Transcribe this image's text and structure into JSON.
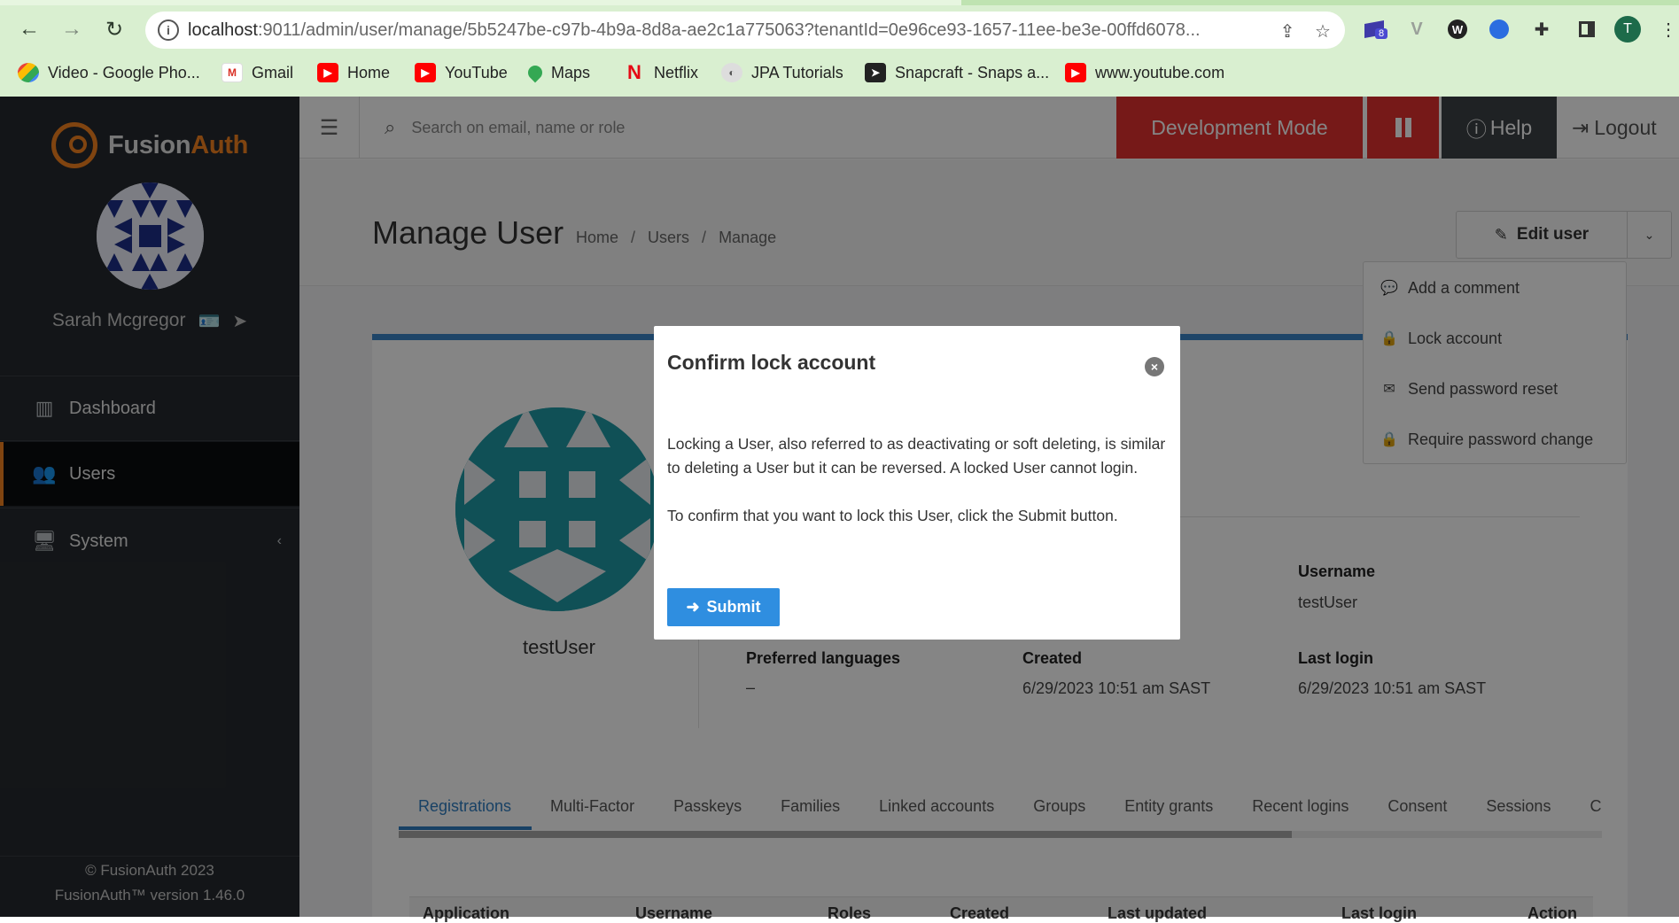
{
  "browser": {
    "url_host": "localhost",
    "url_rest": ":9011/admin/user/manage/5b5247be-c97b-4b9a-8d8a-ae2c1a775063?tenantId=0e96ce93-1657-11ee-be3e-00ffd6078...",
    "extension_badge": "8",
    "profile_initial": "T",
    "bookmarks": [
      {
        "label": "Video - Google Pho...",
        "icon": "google-photos-icon"
      },
      {
        "label": "Gmail",
        "icon": "gmail-icon"
      },
      {
        "label": "Home",
        "icon": "youtube-icon"
      },
      {
        "label": "YouTube",
        "icon": "youtube-icon"
      },
      {
        "label": "Maps",
        "icon": "maps-icon"
      },
      {
        "label": "Netflix",
        "icon": "netflix-icon"
      },
      {
        "label": "JPA Tutorials",
        "icon": "jpa-icon"
      },
      {
        "label": "Snapcraft - Snaps a...",
        "icon": "snapcraft-icon"
      },
      {
        "label": "www.youtube.com",
        "icon": "youtube-icon"
      }
    ]
  },
  "sidebar": {
    "logo_part1": "Fusion",
    "logo_part2": "Auth",
    "user_name": "Sarah Mcgregor",
    "items": [
      {
        "label": "Dashboard",
        "icon": "dashboard-icon"
      },
      {
        "label": "Users",
        "icon": "users-icon"
      },
      {
        "label": "System",
        "icon": "monitor-icon",
        "chevron": "‹"
      }
    ],
    "footer_copyright": "© FusionAuth 2023",
    "footer_version": "FusionAuth™ version 1.46.0"
  },
  "topbar": {
    "search_placeholder": "Search on email, name or role",
    "dev_mode": "Development Mode",
    "help": "Help",
    "logout": "Logout"
  },
  "page": {
    "title": "Manage User",
    "breadcrumb": [
      "Home",
      "Users",
      "Manage"
    ],
    "edit_user": "Edit user"
  },
  "dropdown": {
    "items": [
      {
        "label": "Add a comment",
        "icon": "comment-icon"
      },
      {
        "label": "Lock account",
        "icon": "lock-icon"
      },
      {
        "label": "Send password reset",
        "icon": "envelope-icon"
      },
      {
        "label": "Require password change",
        "icon": "lock-icon"
      }
    ]
  },
  "user": {
    "display_name": "testUser",
    "fields": {
      "username_label": "Username",
      "username_value": "testUser",
      "preferred_languages_label": "Preferred languages",
      "preferred_languages_value": "–",
      "created_label": "Created",
      "created_value": "6/29/2023 10:51 am SAST",
      "last_login_label": "Last login",
      "last_login_value": "6/29/2023 10:51 am SAST"
    }
  },
  "tabs": [
    "Registrations",
    "Multi-Factor",
    "Passkeys",
    "Families",
    "Linked accounts",
    "Groups",
    "Entity grants",
    "Recent logins",
    "Consent",
    "Sessions",
    "C"
  ],
  "table_headers": [
    "Application",
    "Username",
    "Roles",
    "Created",
    "Last updated",
    "Last login",
    "Action"
  ],
  "modal": {
    "title": "Confirm lock account",
    "body_1": "Locking a User, also referred to as deactivating or soft deleting, is similar to deleting a User but it can be reversed. A locked User cannot login.",
    "body_2": "To confirm that you want to lock this User, click the Submit button.",
    "submit": "Submit"
  },
  "colors": {
    "brand_orange": "#f58320",
    "danger_red": "#e2312f",
    "primary_blue": "#2f8ee0",
    "sidebar_bg": "#262a2e"
  }
}
